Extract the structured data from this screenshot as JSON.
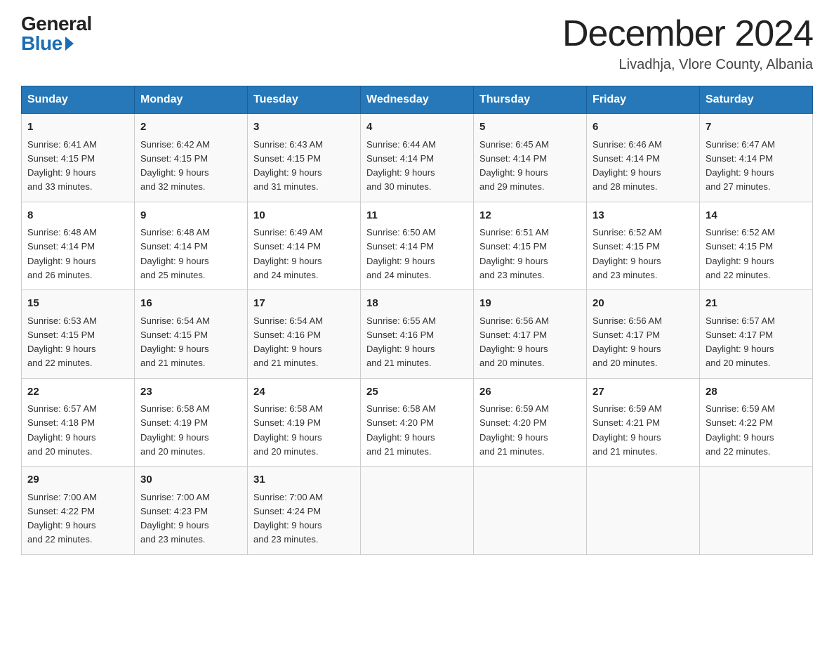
{
  "logo": {
    "general": "General",
    "blue": "Blue"
  },
  "header": {
    "title": "December 2024",
    "subtitle": "Livadhja, Vlore County, Albania"
  },
  "days_of_week": [
    "Sunday",
    "Monday",
    "Tuesday",
    "Wednesday",
    "Thursday",
    "Friday",
    "Saturday"
  ],
  "weeks": [
    [
      {
        "day": "1",
        "sunrise": "6:41 AM",
        "sunset": "4:15 PM",
        "daylight": "9 hours and 33 minutes."
      },
      {
        "day": "2",
        "sunrise": "6:42 AM",
        "sunset": "4:15 PM",
        "daylight": "9 hours and 32 minutes."
      },
      {
        "day": "3",
        "sunrise": "6:43 AM",
        "sunset": "4:15 PM",
        "daylight": "9 hours and 31 minutes."
      },
      {
        "day": "4",
        "sunrise": "6:44 AM",
        "sunset": "4:14 PM",
        "daylight": "9 hours and 30 minutes."
      },
      {
        "day": "5",
        "sunrise": "6:45 AM",
        "sunset": "4:14 PM",
        "daylight": "9 hours and 29 minutes."
      },
      {
        "day": "6",
        "sunrise": "6:46 AM",
        "sunset": "4:14 PM",
        "daylight": "9 hours and 28 minutes."
      },
      {
        "day": "7",
        "sunrise": "6:47 AM",
        "sunset": "4:14 PM",
        "daylight": "9 hours and 27 minutes."
      }
    ],
    [
      {
        "day": "8",
        "sunrise": "6:48 AM",
        "sunset": "4:14 PM",
        "daylight": "9 hours and 26 minutes."
      },
      {
        "day": "9",
        "sunrise": "6:48 AM",
        "sunset": "4:14 PM",
        "daylight": "9 hours and 25 minutes."
      },
      {
        "day": "10",
        "sunrise": "6:49 AM",
        "sunset": "4:14 PM",
        "daylight": "9 hours and 24 minutes."
      },
      {
        "day": "11",
        "sunrise": "6:50 AM",
        "sunset": "4:14 PM",
        "daylight": "9 hours and 24 minutes."
      },
      {
        "day": "12",
        "sunrise": "6:51 AM",
        "sunset": "4:15 PM",
        "daylight": "9 hours and 23 minutes."
      },
      {
        "day": "13",
        "sunrise": "6:52 AM",
        "sunset": "4:15 PM",
        "daylight": "9 hours and 23 minutes."
      },
      {
        "day": "14",
        "sunrise": "6:52 AM",
        "sunset": "4:15 PM",
        "daylight": "9 hours and 22 minutes."
      }
    ],
    [
      {
        "day": "15",
        "sunrise": "6:53 AM",
        "sunset": "4:15 PM",
        "daylight": "9 hours and 22 minutes."
      },
      {
        "day": "16",
        "sunrise": "6:54 AM",
        "sunset": "4:15 PM",
        "daylight": "9 hours and 21 minutes."
      },
      {
        "day": "17",
        "sunrise": "6:54 AM",
        "sunset": "4:16 PM",
        "daylight": "9 hours and 21 minutes."
      },
      {
        "day": "18",
        "sunrise": "6:55 AM",
        "sunset": "4:16 PM",
        "daylight": "9 hours and 21 minutes."
      },
      {
        "day": "19",
        "sunrise": "6:56 AM",
        "sunset": "4:17 PM",
        "daylight": "9 hours and 20 minutes."
      },
      {
        "day": "20",
        "sunrise": "6:56 AM",
        "sunset": "4:17 PM",
        "daylight": "9 hours and 20 minutes."
      },
      {
        "day": "21",
        "sunrise": "6:57 AM",
        "sunset": "4:17 PM",
        "daylight": "9 hours and 20 minutes."
      }
    ],
    [
      {
        "day": "22",
        "sunrise": "6:57 AM",
        "sunset": "4:18 PM",
        "daylight": "9 hours and 20 minutes."
      },
      {
        "day": "23",
        "sunrise": "6:58 AM",
        "sunset": "4:19 PM",
        "daylight": "9 hours and 20 minutes."
      },
      {
        "day": "24",
        "sunrise": "6:58 AM",
        "sunset": "4:19 PM",
        "daylight": "9 hours and 20 minutes."
      },
      {
        "day": "25",
        "sunrise": "6:58 AM",
        "sunset": "4:20 PM",
        "daylight": "9 hours and 21 minutes."
      },
      {
        "day": "26",
        "sunrise": "6:59 AM",
        "sunset": "4:20 PM",
        "daylight": "9 hours and 21 minutes."
      },
      {
        "day": "27",
        "sunrise": "6:59 AM",
        "sunset": "4:21 PM",
        "daylight": "9 hours and 21 minutes."
      },
      {
        "day": "28",
        "sunrise": "6:59 AM",
        "sunset": "4:22 PM",
        "daylight": "9 hours and 22 minutes."
      }
    ],
    [
      {
        "day": "29",
        "sunrise": "7:00 AM",
        "sunset": "4:22 PM",
        "daylight": "9 hours and 22 minutes."
      },
      {
        "day": "30",
        "sunrise": "7:00 AM",
        "sunset": "4:23 PM",
        "daylight": "9 hours and 23 minutes."
      },
      {
        "day": "31",
        "sunrise": "7:00 AM",
        "sunset": "4:24 PM",
        "daylight": "9 hours and 23 minutes."
      },
      null,
      null,
      null,
      null
    ]
  ],
  "labels": {
    "sunrise": "Sunrise:",
    "sunset": "Sunset:",
    "daylight": "Daylight:"
  }
}
